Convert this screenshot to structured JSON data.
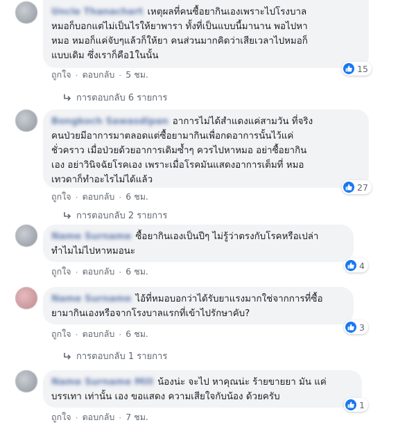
{
  "ui": {
    "like_label": "ถูกใจ",
    "reply_label": "ตอบกลับ",
    "like_icon": "thumbs-up-icon",
    "accent_color": "#1877f2",
    "link_color": "#385898"
  },
  "comments": [
    {
      "author": "Uncle Thanachart",
      "text": "เหตุผลที่คนซื้อยากินเองเพราะไปโรงบาล\nหมอก็บอกแต่ไม่เป็นไรให้ยาพารา ทั้งที่เป็นแบบนี้มานาน พอไปหา\nหมอ หมอก็แค่จับๆแล้วก็ให้ยา คนส่วนมากคิดว่าเสียเวลาไปหมอก็\nแบบเดิม ซึ่งเราก็คือ1ในนั้น",
      "reactions": "15",
      "time": "5 ชม.",
      "replies": "การตอบกลับ 6 รายการ"
    },
    {
      "author": "Bongkoch Sawasdipan",
      "text": "อาการไม่ได้สำแดงแค่สามวัน ที่จริง\nคนป่วยมีอาการมาตลอดแต่ซื้อยามากินเพื่อกดอาการนั้นไว้แค่\nชั่วคราว เมื่อป่วยด้วยอาการเดิมซ้ำๆ ควรไปหาหมอ อย่าซื้อยากิน\nเอง อย่าวินิจฉัยโรคเอง เพราะเมื่อโรคมันแสดงอาการเต็มที่ หมอ\nเทวดาก็ทำอะไรไม่ได้แล้ว",
      "reactions": "27",
      "time": "6 ชม.",
      "replies": "การตอบกลับ 2 รายการ"
    },
    {
      "author": "Name Surname",
      "text": "ซื้อยากินเองเป็นปีๆ ไม่รู้ว่าตรงกับโรคหรือเปล่า\nทำไมไม่ไปหาหมอนะ",
      "reactions": "4",
      "time": "6 ชม.",
      "replies": ""
    },
    {
      "author": "Name Surname",
      "text": "ไอ้ที่หมอบอกว่าได้รับยาแรงมากใช่จากการที่ซื้อ\nยามากินเองหรือจากโรงบาลแรกที่เข้าไปรักษาคับ?",
      "reactions": "3",
      "time": "6 ชม.",
      "replies": "การตอบกลับ 1 รายการ"
    },
    {
      "author": "Name Surname Mill",
      "text": "น้องน่ะ จะไป หาคุณน่ะ ร้ายขายยา มัน แค่\nบรรเทา เท่านั้น เอง ขอแสดง ความเสียใจกับน้อง ด้วยครับ",
      "reactions": "1",
      "time": "7 ชม.",
      "replies": ""
    }
  ]
}
